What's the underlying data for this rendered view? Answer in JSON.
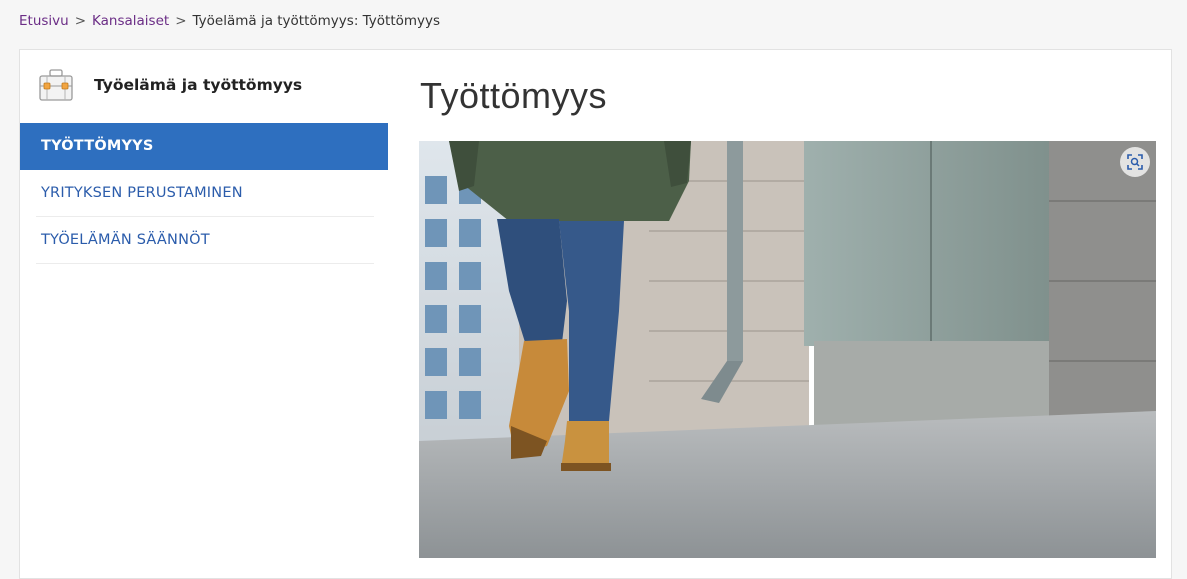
{
  "breadcrumb": {
    "items": [
      "Etusivu",
      "Kansalaiset"
    ],
    "separator": ">",
    "current": "Työelämä ja työttömyys: Työttömyys"
  },
  "sidebar": {
    "title": "Työelämä ja työttömyys",
    "icon": "briefcase-icon",
    "items": [
      {
        "label": "TYÖTTÖMYYS",
        "active": true
      },
      {
        "label": "YRITYKSEN PERUSTAMINEN",
        "active": false
      },
      {
        "label": "TYÖELÄMÄN SÄÄNNÖT",
        "active": false
      }
    ]
  },
  "main": {
    "title": "Työttömyys",
    "hero_image": "person-walking-on-street-photo",
    "zoom_icon": "image-search-icon"
  },
  "colors": {
    "accent": "#2e6fbf",
    "link": "#2b5cab",
    "breadcrumb_link": "#6b2d86"
  }
}
